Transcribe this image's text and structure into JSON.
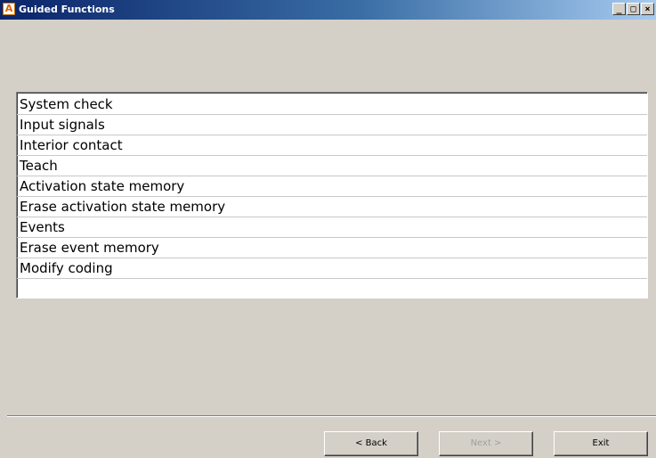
{
  "window": {
    "title": "Guided Functions",
    "icon_letter": "A",
    "minimize": "_",
    "maximize": "□",
    "close": "×"
  },
  "functions": [
    "System check",
    "Input signals",
    "Interior contact",
    "Teach",
    "Activation state memory",
    "Erase activation state memory",
    "Events",
    "Erase event memory",
    "Modify coding"
  ],
  "buttons": {
    "back": "< Back",
    "next": "Next >",
    "exit": "Exit",
    "next_enabled": false
  }
}
